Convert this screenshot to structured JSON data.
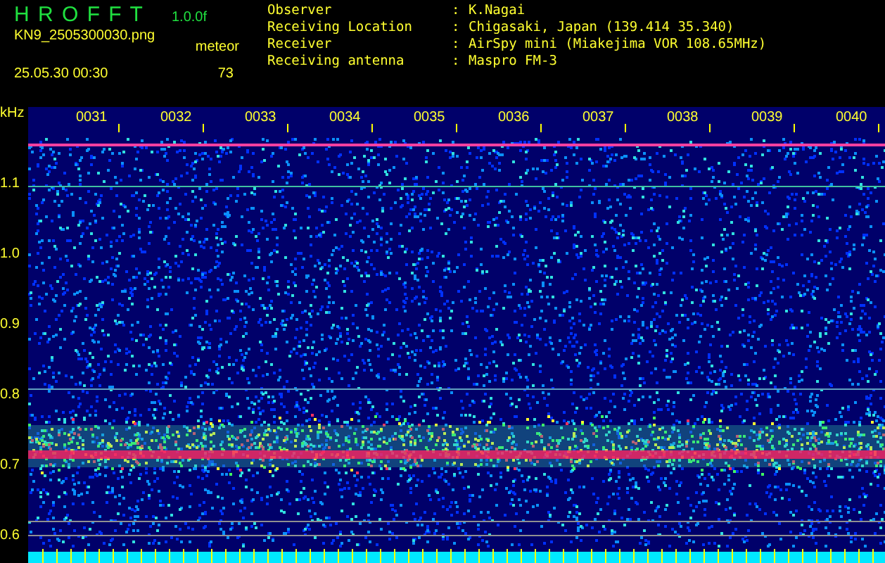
{
  "header": {
    "app_name": "H R O F F T",
    "version": "1.0.0f",
    "filename": "KN9_2505300030.png",
    "mode_label": "meteor",
    "count": "73",
    "datetime": "25.05.30 00:30"
  },
  "info": [
    {
      "label": "Observer",
      "separator": ":",
      "value": "K.Nagai"
    },
    {
      "label": "Receiving Location",
      "separator": ":",
      "value": "Chigasaki, Japan (139.414 35.340)"
    },
    {
      "label": "Receiver",
      "separator": ":",
      "value": "AirSpy mini (Miakejima VOR 108.65MHz)"
    },
    {
      "label": "Receiving antenna",
      "separator": ":",
      "value": "Maspro FM-3"
    }
  ],
  "spectrogram": {
    "unit": "kHz",
    "y_labels": [
      "1.1",
      "1.0",
      "0.9",
      "0.8",
      "0.7",
      "0.6"
    ],
    "time_labels": [
      "0031",
      "0032",
      "0033",
      "0034",
      "0035",
      "0036",
      "0037",
      "0038",
      "0039",
      "0040"
    ]
  }
}
